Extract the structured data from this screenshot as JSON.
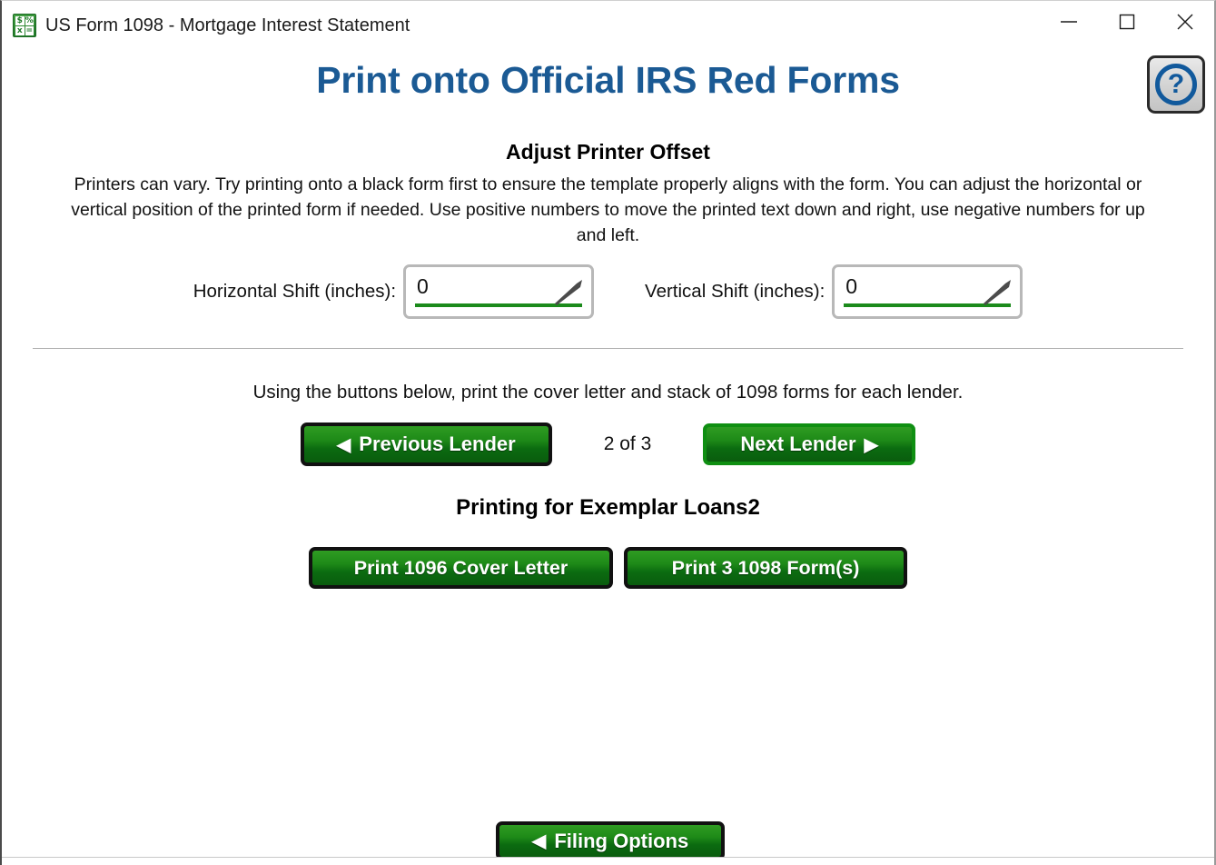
{
  "window": {
    "title": "US Form 1098 - Mortgage Interest Statement",
    "app_icon": "spreadsheet-calculator-icon",
    "icon_glyphs": [
      "$",
      "%",
      "x",
      "="
    ],
    "controls": {
      "minimize": "minimize-icon",
      "maximize": "maximize-icon",
      "close": "close-icon"
    }
  },
  "header": {
    "heading": "Print onto Official IRS Red Forms",
    "heading_color": "#1b5a94",
    "help_button": {
      "glyph": "?",
      "name": "help-icon",
      "accent_color": "#11599c"
    }
  },
  "offset_section": {
    "title": "Adjust Printer Offset",
    "description": "Printers can vary. Try printing onto a black form first to ensure the template properly aligns with the form. You can adjust the horizontal or vertical position of the printed form if needed. Use positive numbers to move the printed text down and right, use negative numbers for up and left.",
    "horizontal": {
      "label": "Horizontal Shift (inches):",
      "value": "0",
      "placeholder": "0"
    },
    "vertical": {
      "label": "Vertical Shift (inches):",
      "value": "0",
      "placeholder": "0"
    },
    "underline_color": "#1b8a1b"
  },
  "lender_section": {
    "intro": "Using the buttons below, print the cover letter and stack of 1098 forms for each lender.",
    "previous_button": "Previous Lender",
    "previous_arrow": "◀",
    "next_button": "Next Lender",
    "next_arrow": "▶",
    "counter": "2 of 3",
    "printing_for": "Printing for Exemplar Loans2",
    "print_cover_button": "Print 1096 Cover Letter",
    "print_forms_button": "Print 3 1098 Form(s)"
  },
  "footer": {
    "filing_options_button": "Filing Options",
    "filing_options_arrow": "◀"
  }
}
